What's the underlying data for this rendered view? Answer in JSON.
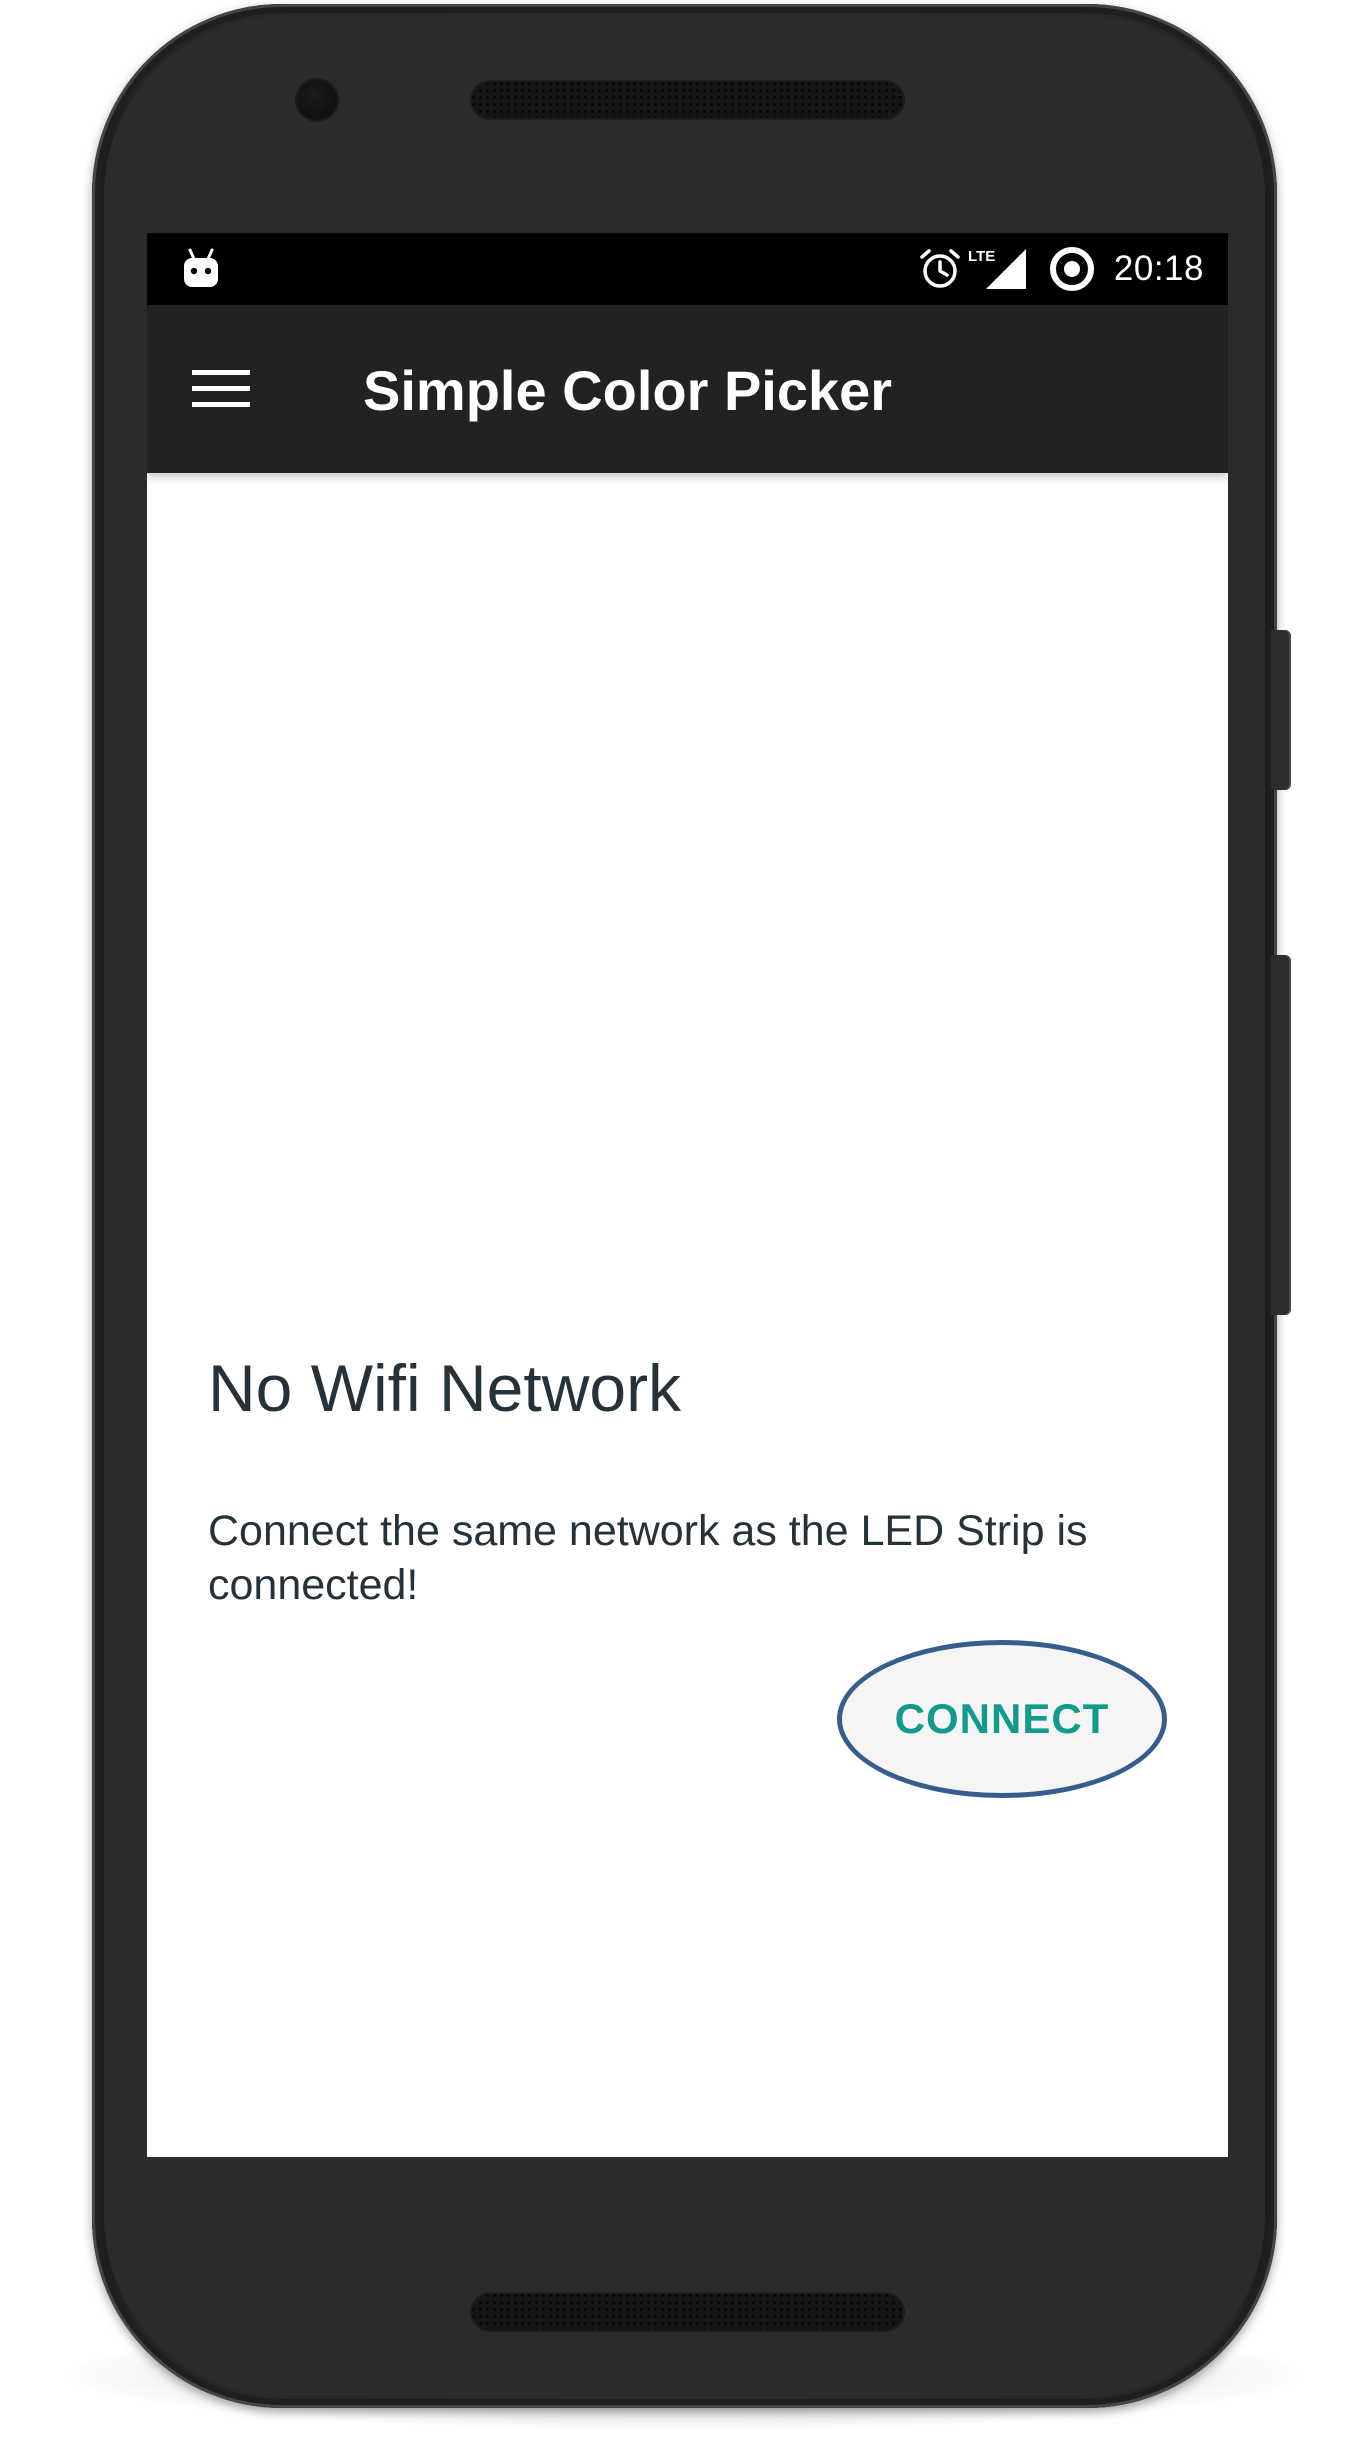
{
  "status_bar": {
    "time": "20:18",
    "network_label": "LTE",
    "icons": [
      "android-icon",
      "alarm-icon",
      "lte-signal-icon",
      "sync-icon"
    ]
  },
  "app_bar": {
    "title": "Simple Color Picker",
    "menu_icon": "hamburger-menu-icon"
  },
  "content": {
    "heading": "No Wifi Network",
    "message": "Connect the same network as the LED Strip is connected!",
    "connect_label": "CONNECT"
  },
  "colors": {
    "app_bar": "#222222",
    "status_bar": "#000000",
    "text": "#26323a",
    "accent": "#129b8c",
    "highlight_ring": "#365d8b"
  }
}
